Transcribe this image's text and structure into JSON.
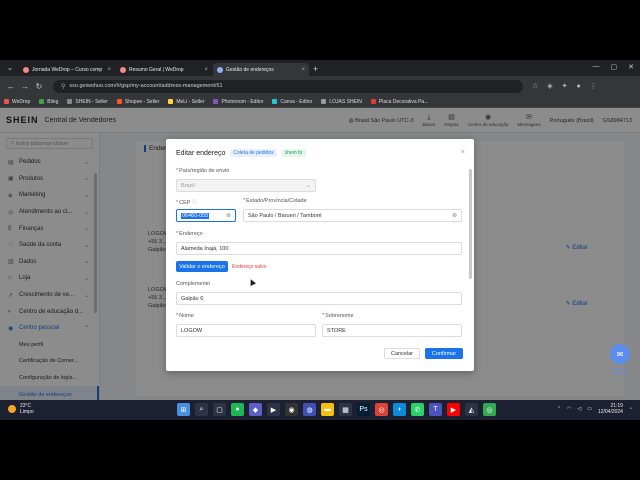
{
  "browser": {
    "tabs": [
      {
        "title": "Jornada WeDrop – Curso comp",
        "color": "#f28b82",
        "active": false
      },
      {
        "title": "Resumo Geral | WeDrop",
        "color": "#f28b82",
        "active": false
      },
      {
        "title": "Gestão de endereços",
        "color": "#8ab4f8",
        "active": true
      }
    ],
    "url": "sso.geiwohuo.com/#/gsp/my-account/address-management/61",
    "bookmarks": [
      {
        "label": "WeDrop",
        "color": "#ef5350"
      },
      {
        "label": "Bling",
        "color": "#43a047"
      },
      {
        "label": "SHEIN - Seller",
        "color": "#888"
      },
      {
        "label": "Shopee - Seller",
        "color": "#ff5722"
      },
      {
        "label": "MeLi - Seller",
        "color": "#fdd835"
      },
      {
        "label": "Photoroom - Editor",
        "color": "#7e57c2"
      },
      {
        "label": "Canva - Editor",
        "color": "#26c6da"
      },
      {
        "label": "LOJAS SHEIN",
        "color": "#999"
      },
      {
        "label": "Placa Decorativa Pa...",
        "color": "#e53935"
      }
    ]
  },
  "portal": {
    "logo": "SHEIN",
    "title": "Central de Vendedores",
    "region": "Brasil São Paulo UTC-3",
    "nav_icons": [
      {
        "icon": "download-icon",
        "label": "Baixar"
      },
      {
        "icon": "rules-icon",
        "label": "Regras"
      },
      {
        "icon": "education-icon",
        "label": "Centro de educação"
      },
      {
        "icon": "message-icon",
        "label": "Mensagens"
      }
    ],
    "language": "Português (Brazil)",
    "account": "GS8984713"
  },
  "sidebar": {
    "search_placeholder": "Insira palavras-chave",
    "items": [
      {
        "label": "Pedidos",
        "icon": "▤"
      },
      {
        "label": "Produtos",
        "icon": "▣"
      },
      {
        "label": "Marketing",
        "icon": "◈"
      },
      {
        "label": "Atendimento ao cl...",
        "icon": "◎"
      },
      {
        "label": "Finanças",
        "icon": "$"
      },
      {
        "label": "Saúde da conta",
        "icon": "♡"
      },
      {
        "label": "Dados",
        "icon": "▥"
      },
      {
        "label": "Loja",
        "icon": "⌂"
      },
      {
        "label": "Crescimento de ve...",
        "icon": "↗"
      },
      {
        "label": "Centro de educação d...",
        "icon": "◐"
      },
      {
        "label": "Centro pessoal",
        "icon": "◉"
      }
    ],
    "sub_items": [
      {
        "label": "Meu perfil",
        "active": false
      },
      {
        "label": "Certificação de Comer...",
        "active": false
      },
      {
        "label": "Configuração de logís...",
        "active": false
      },
      {
        "label": "Gestão de endereços",
        "active": true
      }
    ]
  },
  "background": {
    "section_title": "Endereço",
    "rows": [
      {
        "line1": "LOGOW",
        "line2": "+55 3...",
        "line3": "Galpão 6"
      },
      {
        "line1": "LOGOW",
        "line2": "+55 3...",
        "line3": "Galpão..."
      }
    ],
    "edit_label": "Editar"
  },
  "modal": {
    "title": "Editar endereço",
    "tag1": "Coleta de pedidos",
    "tag2": "shein br",
    "country_label": "País/região de envio",
    "country_value": "Brazil",
    "cep_label": "CEP",
    "cep_value": "06460-055",
    "state_label": "Estado/Província/Cidade",
    "state_value": "São Paulo / Barueri / Tamboré",
    "address_label": "Endereço",
    "address_value": "Alameda Inajá, 100",
    "validate_label": "Validar o endereço",
    "invalid_label": "Endereço salvo",
    "complement_label": "Complemento",
    "complement_value": "Galpão 6",
    "name_label": "Nome",
    "name_value": "LOGOW",
    "surname_label": "Sobrenome",
    "surname_value": "STORE",
    "cancel_label": "Cancelar",
    "confirm_label": "Confirmar"
  },
  "chat": {
    "label": "Suporte ao vendedor"
  },
  "taskbar": {
    "temp": "23°C",
    "weather": "Limpo",
    "time": "21:19",
    "date": "12/04/2024",
    "apps": [
      {
        "icon": "windows-icon",
        "color": "#4a90e2",
        "glyph": "⊞"
      },
      {
        "icon": "search-icon",
        "color": "#2d3246",
        "glyph": "⌕"
      },
      {
        "icon": "task-view-icon",
        "color": "#2d3246",
        "glyph": "▢"
      },
      {
        "icon": "spotify-icon",
        "color": "#1db954",
        "glyph": "●"
      },
      {
        "icon": "chat-icon",
        "color": "#5b5fc7",
        "glyph": "◆"
      },
      {
        "icon": "media-icon",
        "color": "#2d3246",
        "glyph": "▶"
      },
      {
        "icon": "obs-icon",
        "color": "#333",
        "glyph": "◉"
      },
      {
        "icon": "vpn-icon",
        "color": "#3f51b5",
        "glyph": "◍"
      },
      {
        "icon": "folder-icon",
        "color": "#f4c20d",
        "glyph": "▬"
      },
      {
        "icon": "store-icon",
        "color": "#2d3246",
        "glyph": "▦"
      },
      {
        "icon": "photoshop-icon",
        "color": "#001e36",
        "glyph": "Ps"
      },
      {
        "icon": "chrome-icon",
        "color": "#db4437",
        "glyph": "◎"
      },
      {
        "icon": "edge-icon",
        "color": "#0c8bd8",
        "glyph": "◗"
      },
      {
        "icon": "whatsapp-icon",
        "color": "#25d366",
        "glyph": "✆"
      },
      {
        "icon": "teams-icon",
        "color": "#4b53bc",
        "glyph": "T"
      },
      {
        "icon": "youtube-icon",
        "color": "#ff0000",
        "glyph": "▶"
      },
      {
        "icon": "photos-icon",
        "color": "#2d3246",
        "glyph": "◭"
      },
      {
        "icon": "chrome-alt-icon",
        "color": "#34a853",
        "glyph": "◎"
      }
    ]
  }
}
